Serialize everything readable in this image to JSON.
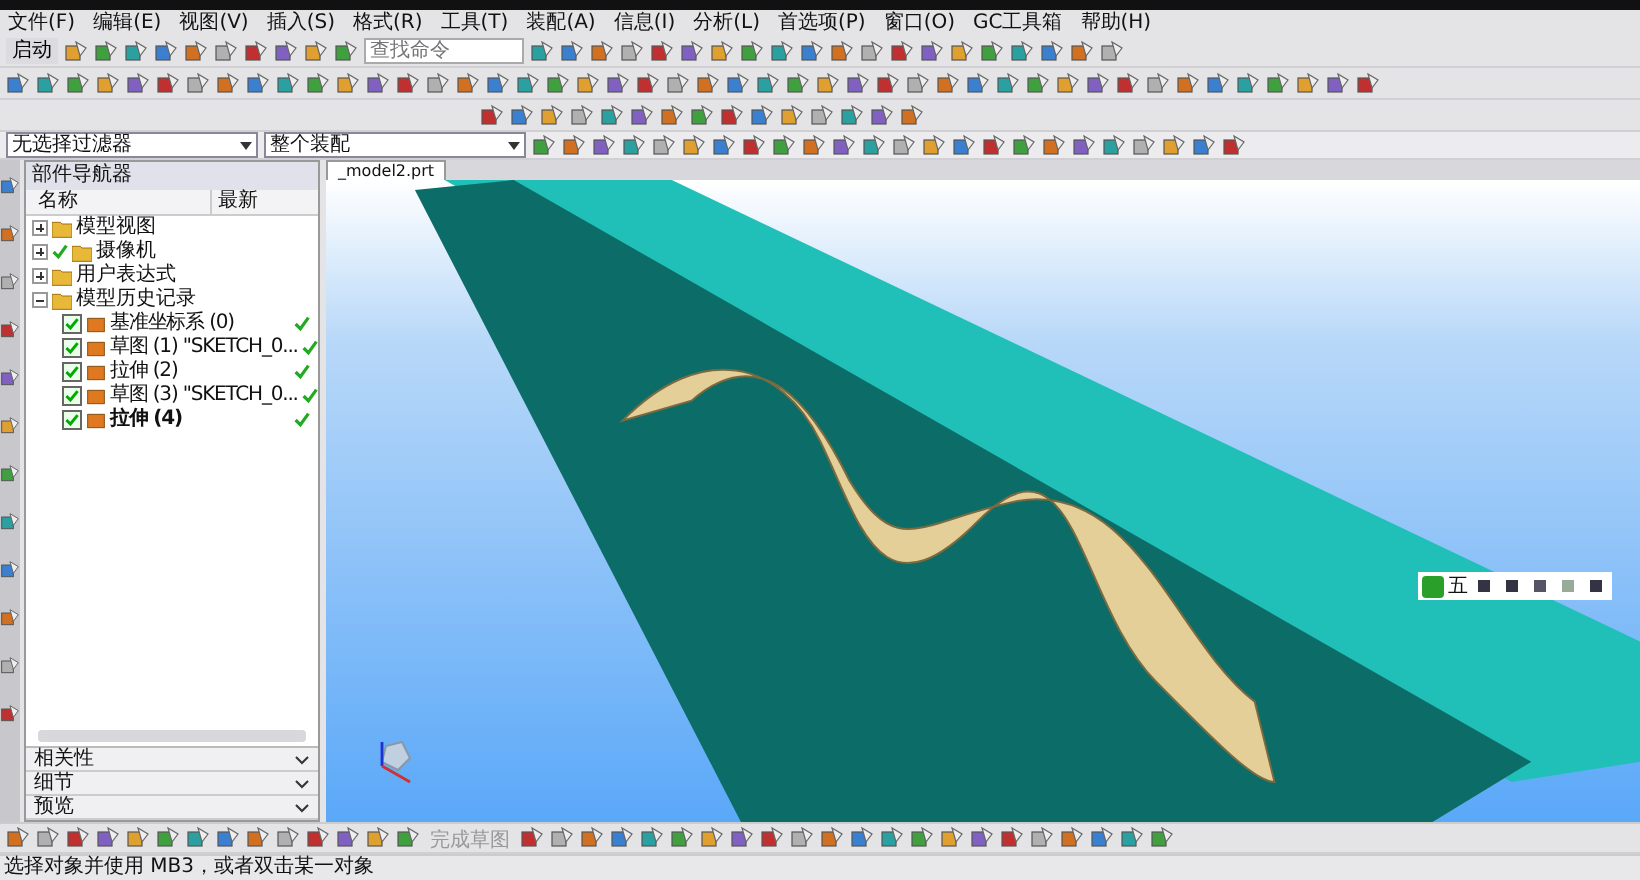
{
  "menu": [
    "文件(F)",
    "编辑(E)",
    "视图(V)",
    "插入(S)",
    "格式(R)",
    "工具(T)",
    "装配(A)",
    "信息(I)",
    "分析(L)",
    "首选项(P)",
    "窗口(O)",
    "GC工具箱",
    "帮助(H)"
  ],
  "toolbar": {
    "start_button": "启动",
    "search": {
      "placeholder": "查找命令"
    }
  },
  "selection_bar": {
    "filter": "无选择过滤器",
    "scope": "整个装配"
  },
  "navigator": {
    "title": "部件导航器",
    "columns": [
      "名称",
      "最新"
    ],
    "tree": [
      {
        "label": "模型视图",
        "expanded": false,
        "checked": false
      },
      {
        "label": "摄像机",
        "expanded": false,
        "checked": true
      },
      {
        "label": "用户表达式",
        "expanded": false,
        "checked": false
      },
      {
        "label": "模型历史记录",
        "expanded": true,
        "checked": false,
        "children": [
          {
            "label": "基准坐标系 (0)",
            "checked": true,
            "latest": true
          },
          {
            "label": "草图 (1) \"SKETCH_0...",
            "checked": true,
            "latest": true
          },
          {
            "label": "拉伸 (2)",
            "checked": true,
            "latest": true
          },
          {
            "label": "草图 (3) \"SKETCH_0...",
            "checked": true,
            "latest": true
          },
          {
            "label": "拉伸 (4)",
            "checked": true,
            "latest": true
          }
        ]
      }
    ],
    "panels": [
      {
        "label": "相关性",
        "expanded": false
      },
      {
        "label": "细节",
        "expanded": false
      },
      {
        "label": "预览",
        "expanded": false
      }
    ]
  },
  "viewport": {
    "tab": "_model2.prt"
  },
  "ime_bar": {
    "label": "五"
  },
  "sketch_toolbar": {
    "finish_sketch": {
      "label": "完成草图",
      "disabled": true
    }
  },
  "status_bar": {
    "message": "选择对象并使用 MB3，或者双击某一对象"
  }
}
